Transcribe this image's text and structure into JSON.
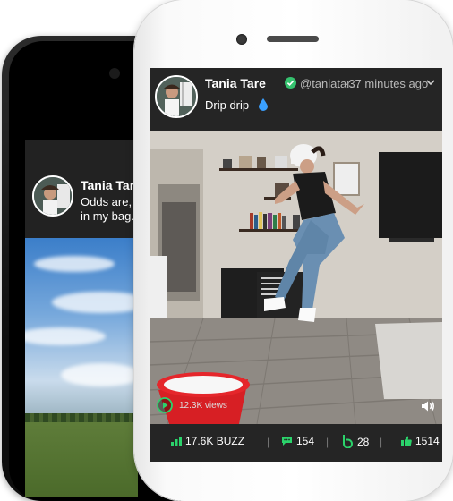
{
  "colors": {
    "accent": "#2bd36b",
    "verified": "#35c26f",
    "caption_drop": "#3aa0ff",
    "screen_bg": "#252525"
  },
  "back_post": {
    "name": "Tania Tare",
    "text": "Odds are,\nin my bag..."
  },
  "post": {
    "name": "Tania Tare",
    "verified_icon": "verified-check-icon",
    "handle": "@taniatar...",
    "time": "·37 minutes ago",
    "caption": "Drip drip",
    "caption_icon": "droplet-icon",
    "menu_icon": "chevron-down-icon"
  },
  "video": {
    "views": "12.3K views",
    "play_icon": "play-icon",
    "sound_icon": "speaker-icon"
  },
  "stats": {
    "buzz": "17.6K BUZZ",
    "comments": "154",
    "rebuzz": "28",
    "likes": "1514"
  }
}
